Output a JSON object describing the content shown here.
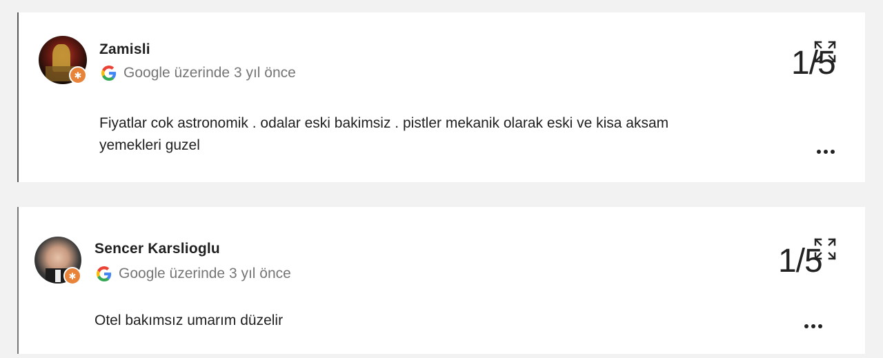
{
  "reviews": [
    {
      "author": "Zamisli",
      "source": "Google üzerinde 3 yıl önce",
      "text_lines": [
        "Fiyatlar cok astronomik . odalar eski bakimsiz . pistler mekanik olarak eski ve kisa aksam",
        "yemekleri guzel"
      ],
      "photo_counter": "1/5",
      "badge_icon": "star-badge-icon",
      "colors": {
        "badge": "#e8833a"
      }
    },
    {
      "author": "Sencer Karslioglu",
      "source": "Google üzerinde 3 yıl önce",
      "text_lines": [
        "Otel bakımsız umarım düzelir"
      ],
      "photo_counter": "1/5",
      "badge_icon": "star-badge-icon",
      "colors": {
        "badge": "#e8833a"
      }
    }
  ]
}
